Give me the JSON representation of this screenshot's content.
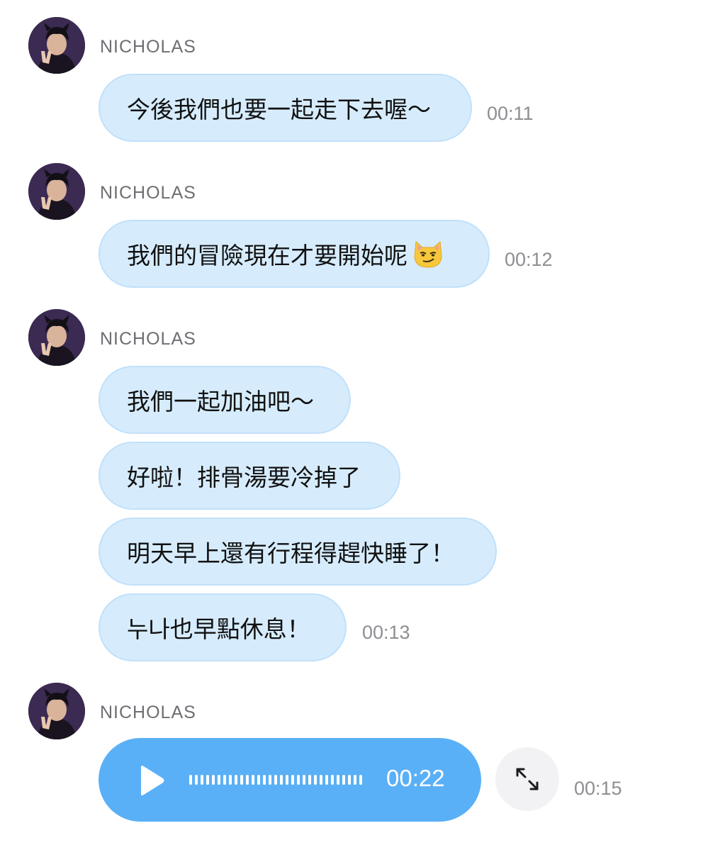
{
  "messages": [
    {
      "sender": "NICHOLAS",
      "avatar_icon": "user-avatar-icon",
      "bubbles": [
        {
          "text": "今後我們也要一起走下去喔～",
          "time": "00:11"
        }
      ]
    },
    {
      "sender": "NICHOLAS",
      "avatar_icon": "user-avatar-icon",
      "bubbles": [
        {
          "text": "我們的冒險現在才要開始呢",
          "emoji": "smirking-cat-emoji",
          "time": "00:12"
        }
      ]
    },
    {
      "sender": "NICHOLAS",
      "avatar_icon": "user-avatar-icon",
      "bubbles": [
        {
          "text": "我們一起加油吧～"
        },
        {
          "text": "好啦！排骨湯要冷掉了"
        },
        {
          "text": "明天早上還有行程得趕快睡了！"
        },
        {
          "text": "누나也早點休息！",
          "time": "00:13"
        }
      ]
    },
    {
      "sender": "NICHOLAS",
      "avatar_icon": "user-avatar-icon",
      "voice": {
        "play_icon": "play-icon",
        "duration": "00:22",
        "expand_icon": "expand-arrows-icon",
        "time": "00:15"
      }
    }
  ],
  "colors": {
    "bubble_bg": "#d6ecfd",
    "voice_bg": "#5ab0f6",
    "sender_text": "#6e6e73",
    "timestamp_text": "#8e8e93"
  }
}
